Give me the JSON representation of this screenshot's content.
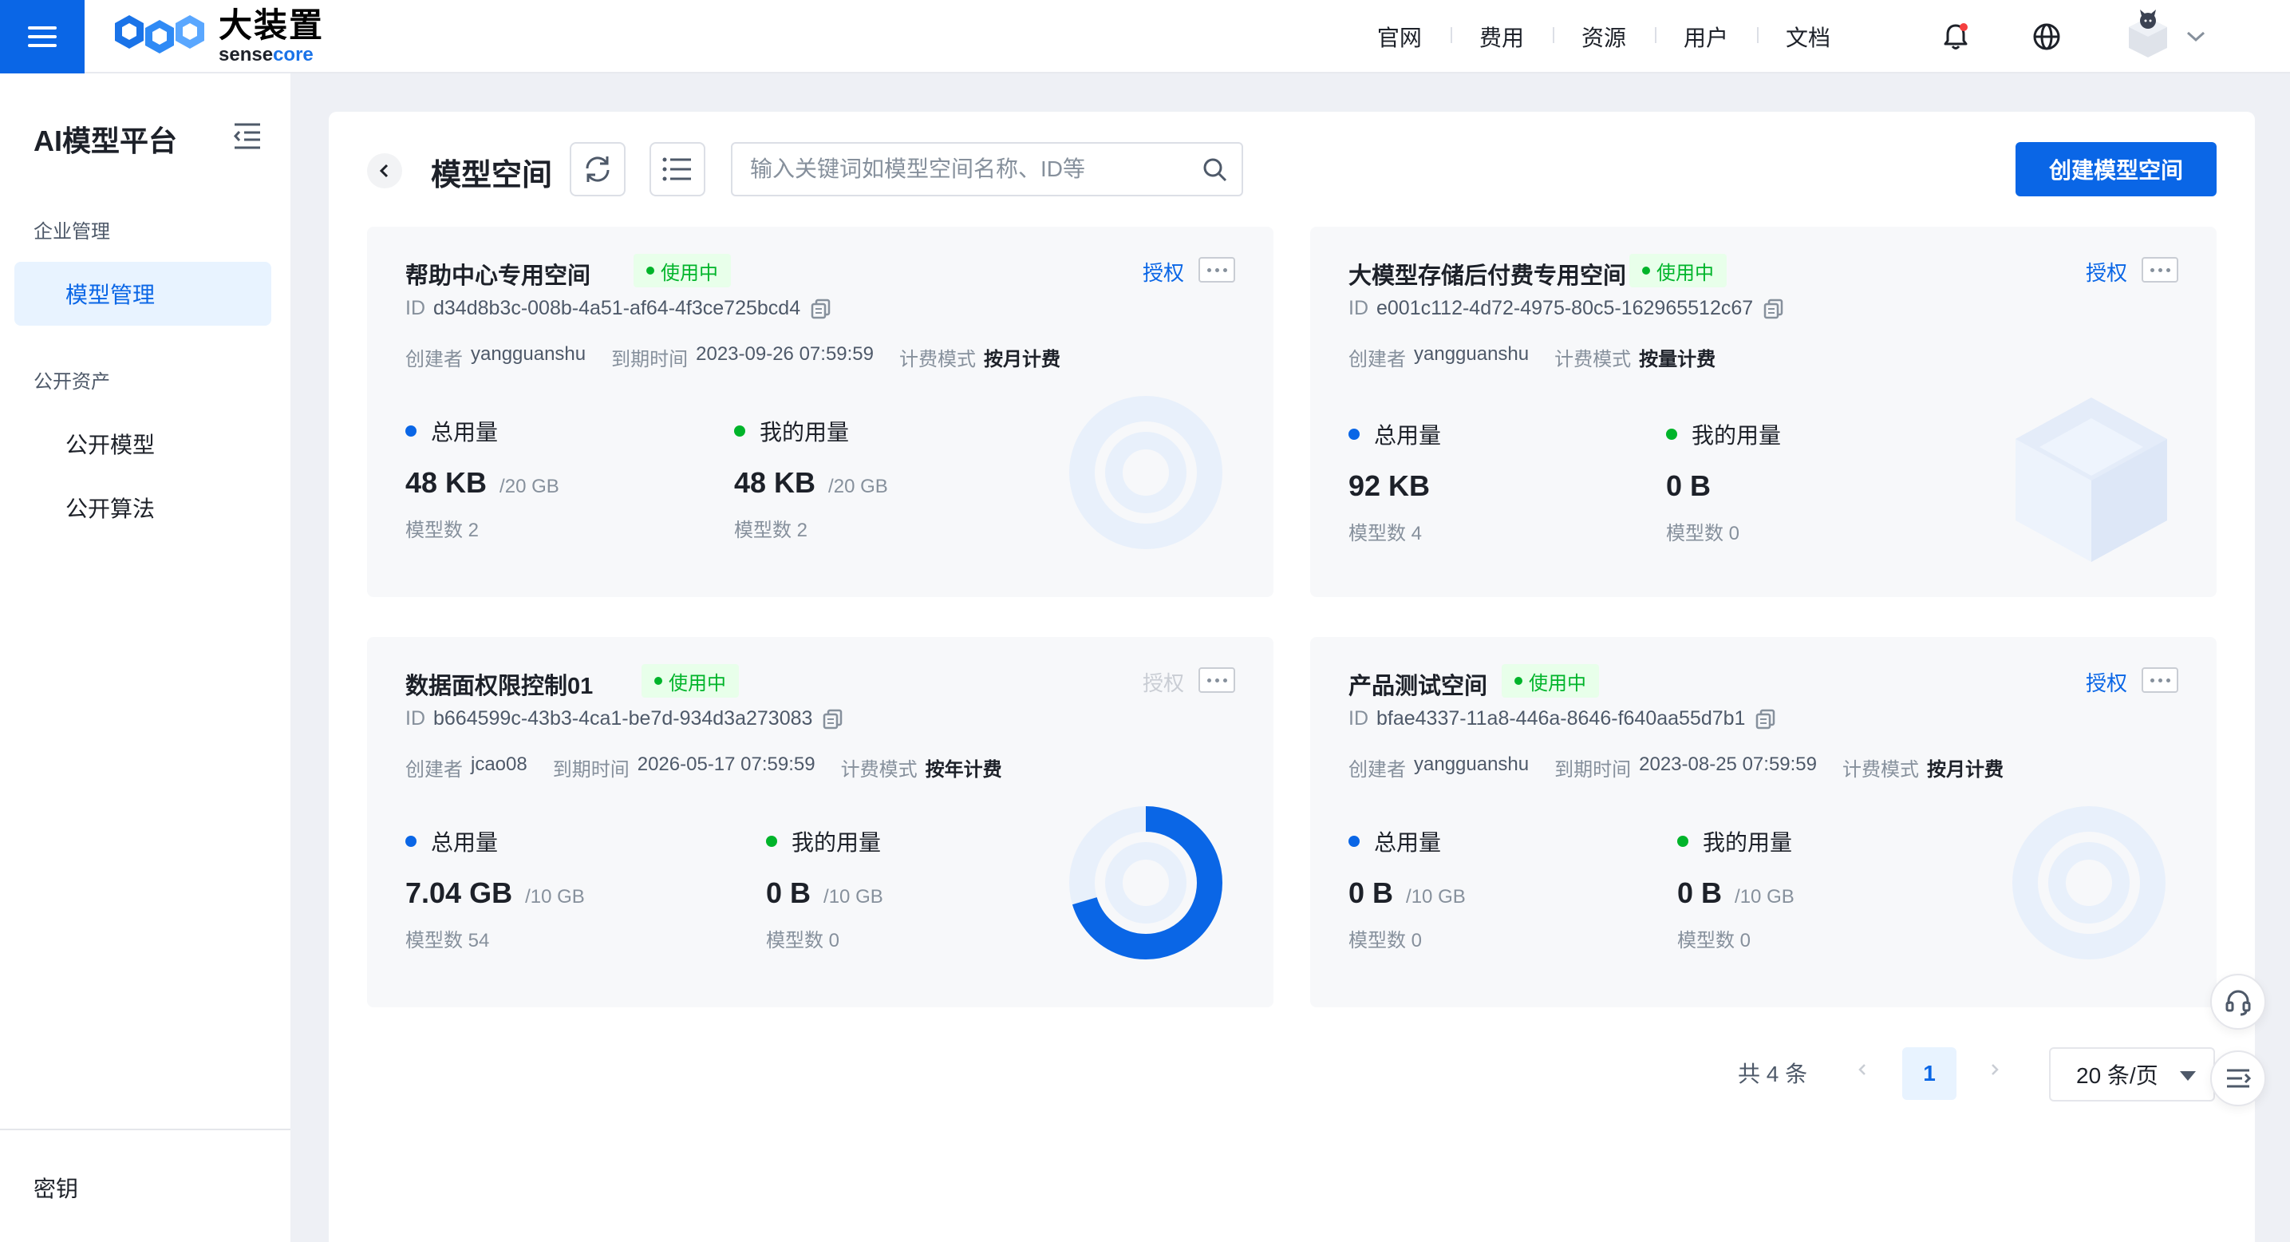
{
  "header": {
    "brand_name": "大装置",
    "brand_sub_a": "sense",
    "brand_sub_b": "core",
    "nav": [
      "官网",
      "费用",
      "资源",
      "用户",
      "文档"
    ],
    "accent_color": "#0a66e6"
  },
  "sidebar": {
    "title": "AI模型平台",
    "group1": "企业管理",
    "item_model_mgmt": "模型管理",
    "group2": "公开资产",
    "item_public_model": "公开模型",
    "item_public_algo": "公开算法",
    "bottom_item": "密钥"
  },
  "main": {
    "title": "模型空间",
    "search_placeholder": "输入关键词如模型空间名称、ID等",
    "create_label": "创建模型空间"
  },
  "labels": {
    "status": "使用中",
    "auth": "授权",
    "id": "ID",
    "creator": "创建者",
    "expire": "到期时间",
    "billing": "计费模式",
    "total_usage": "总用量",
    "my_usage": "我的用量"
  },
  "cards": [
    {
      "name": "帮助中心专用空间",
      "id": "d34d8b3c-008b-4a51-af64-4f3ce725bcd4",
      "creator": "yangguanshu",
      "expire": "2023-09-26 07:59:59",
      "billing": "按月计费",
      "total": {
        "value": "48 KB",
        "quota": "/20 GB",
        "count": "模型数 2"
      },
      "mine": {
        "value": "48 KB",
        "quota": "/20 GB",
        "count": "模型数 2"
      },
      "auth_enabled": true,
      "usage_fraction": 0
    },
    {
      "name": "大模型存储后付费专用空间",
      "id": "e001c112-4d72-4975-80c5-162965512c67",
      "creator": "yangguanshu",
      "billing": "按量计费",
      "total": {
        "value": "92 KB",
        "count": "模型数 4"
      },
      "mine": {
        "value": "0 B",
        "count": "模型数 0"
      },
      "auth_enabled": true
    },
    {
      "name": "数据面权限控制01",
      "id": "b664599c-43b3-4ca1-be7d-934d3a273083",
      "creator": "jcao08",
      "expire": "2026-05-17 07:59:59",
      "billing": "按年计费",
      "total": {
        "value": "7.04 GB",
        "quota": "/10 GB",
        "count": "模型数 54"
      },
      "mine": {
        "value": "0 B",
        "quota": "/10 GB",
        "count": "模型数 0"
      },
      "auth_enabled": false,
      "usage_fraction": 0.704
    },
    {
      "name": "产品测试空间",
      "id": "bfae4337-11a8-446a-8646-f640aa55d7b1",
      "creator": "yangguanshu",
      "expire": "2023-08-25 07:59:59",
      "billing": "按月计费",
      "total": {
        "value": "0 B",
        "quota": "/10 GB",
        "count": "模型数 0"
      },
      "mine": {
        "value": "0 B",
        "quota": "/10 GB",
        "count": "模型数 0"
      },
      "auth_enabled": true,
      "usage_fraction": 0
    }
  ],
  "pagination": {
    "total": "共 4 条",
    "current": "1",
    "page_size": "20 条/页"
  }
}
